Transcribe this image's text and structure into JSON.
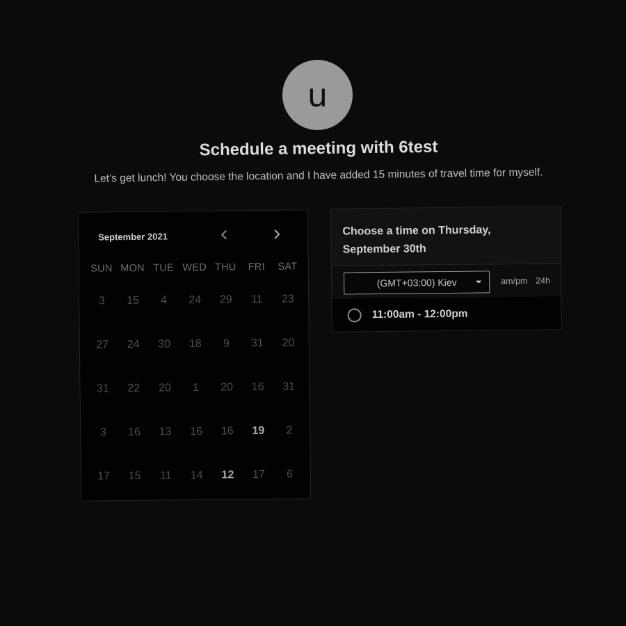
{
  "host": {
    "avatar_letter": "u",
    "title": "Schedule a meeting with 6test",
    "description": "Let’s get lunch! You choose the location and I have added 15 minutes of travel time for myself."
  },
  "calendar": {
    "month_label": "September 2021",
    "prev_icon": "chevron-left-icon",
    "next_icon": "chevron-right-icon",
    "weekdays": [
      "SUN",
      "MON",
      "TUE",
      "WED",
      "THU",
      "FRI",
      "SAT"
    ],
    "weeks": [
      [
        "3",
        "15",
        "4",
        "24",
        "29",
        "11",
        "23"
      ],
      [
        "27",
        "24",
        "30",
        "18",
        "9",
        "31",
        "20"
      ],
      [
        "31",
        "22",
        "20",
        "1",
        "20",
        "16",
        "31"
      ],
      [
        "3",
        "16",
        "13",
        "16",
        "16",
        "19",
        "2"
      ],
      [
        "17",
        "15",
        "11",
        "14",
        "12",
        "17",
        "6"
      ]
    ]
  },
  "time_panel": {
    "header_line1": "Choose a time on Thursday,",
    "header_line2": "September 30th",
    "timezone": "(GMT+03:00) Kiev",
    "format_ampm": "am/pm",
    "format_24h": "24h",
    "slots": [
      "11:00am - 12:00pm"
    ]
  },
  "colors": {
    "background": "#0b0b0b",
    "avatar": "#9a9a9a",
    "panel": "#020202"
  }
}
